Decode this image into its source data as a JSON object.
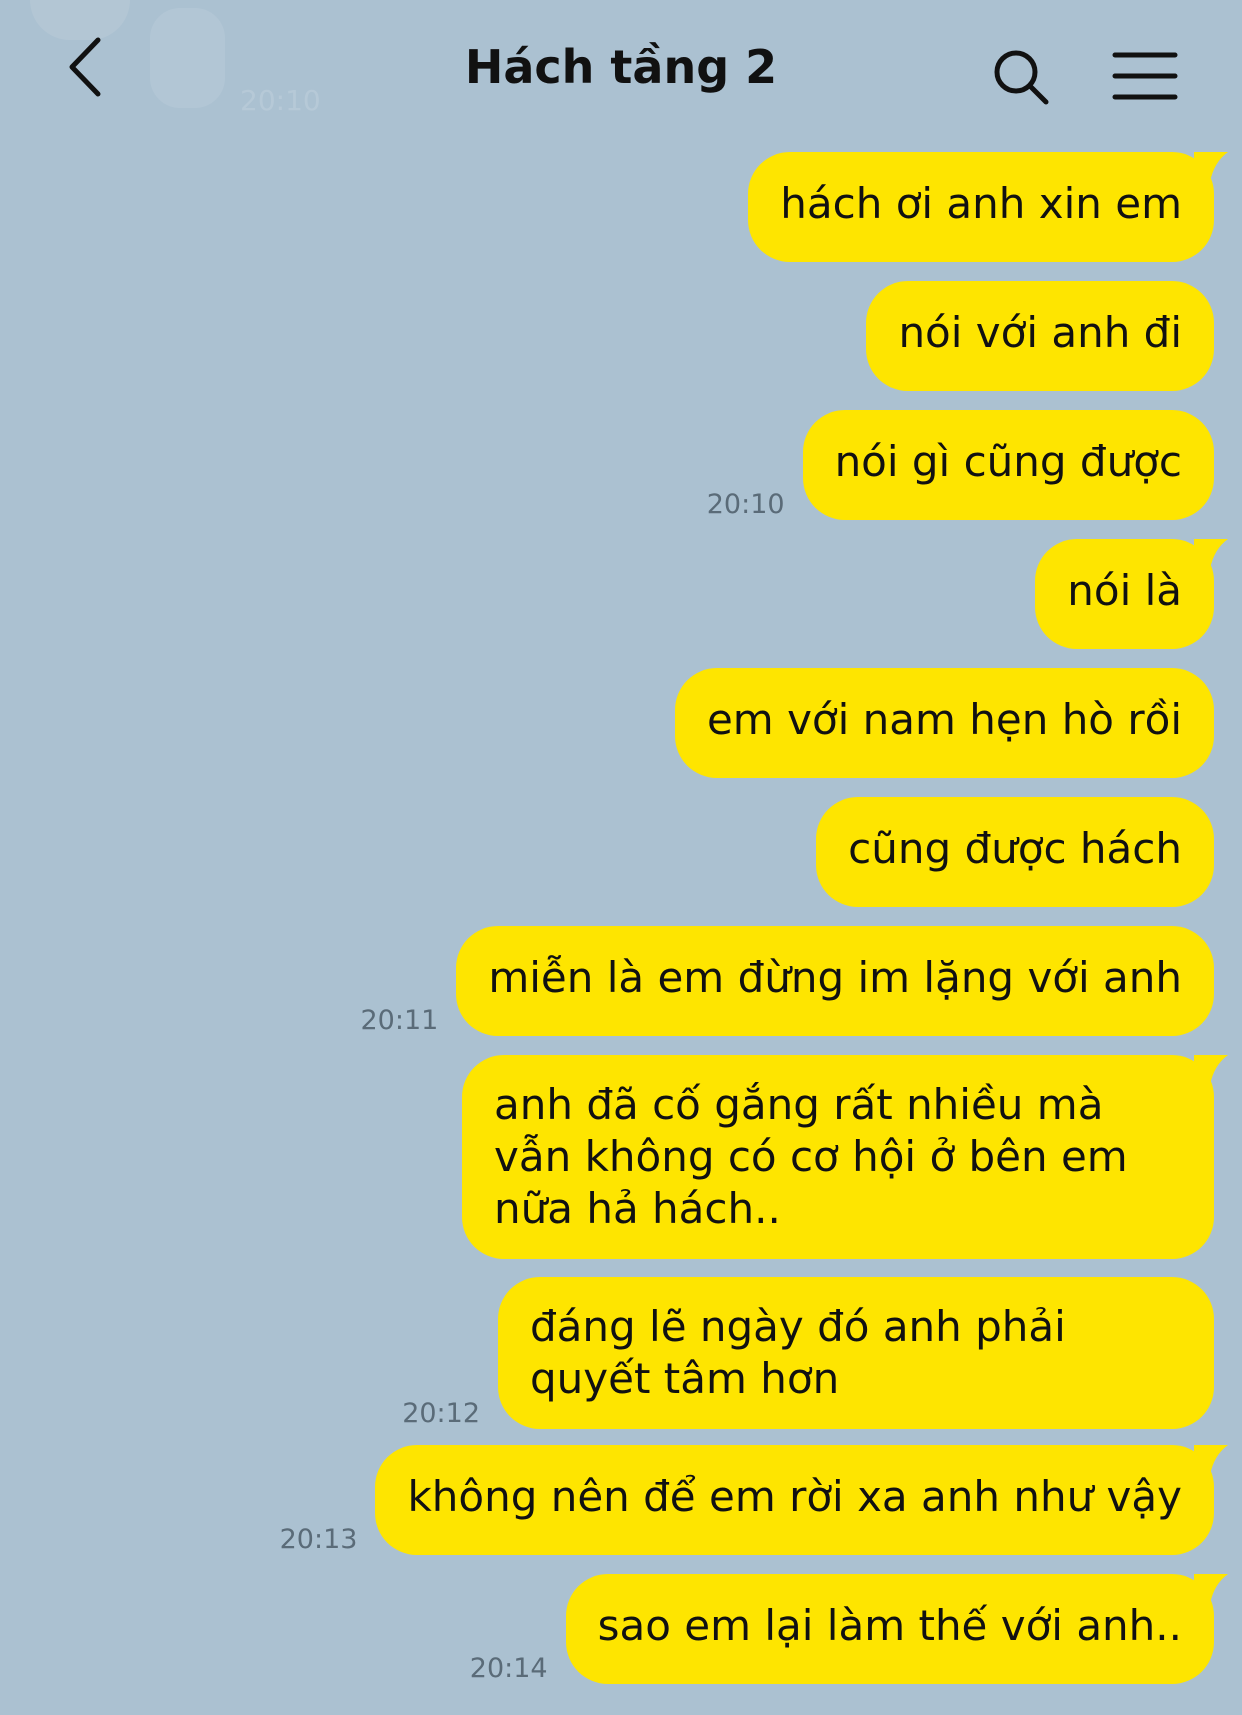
{
  "header": {
    "title": "Hách tầng 2",
    "ghost_time": "20:10",
    "back_icon": "chevron-left-icon",
    "search_icon": "search-icon",
    "menu_icon": "hamburger-menu-icon"
  },
  "colors": {
    "background": "#abc1d1",
    "bubble": "#fee500",
    "text": "#111111",
    "timestamp": "#5a6b78"
  },
  "messages": [
    {
      "text": "hách ơi anh xin em",
      "time": "",
      "tail": true
    },
    {
      "text": "nói với anh đi",
      "time": "",
      "tail": false
    },
    {
      "text": "nói gì cũng được",
      "time": "20:10",
      "tail": false
    },
    {
      "text": "nói là",
      "time": "",
      "tail": true
    },
    {
      "text": "em với nam hẹn hò rồi",
      "time": "",
      "tail": false
    },
    {
      "text": "cũng được hách",
      "time": "",
      "tail": false
    },
    {
      "text": "miễn là em đừng im lặng với anh",
      "time": "20:11",
      "tail": false
    },
    {
      "text": "anh đã cố gắng rất nhiều mà vẫn không có cơ hội ở bên em nữa hả hách..",
      "time": "",
      "tail": true
    },
    {
      "text": "đáng lẽ ngày đó anh phải quyết tâm hơn",
      "time": "20:12",
      "tail": false
    },
    {
      "text": "không nên để em rời xa anh như vậy",
      "time": "20:13",
      "tail": true
    },
    {
      "text": "sao em lại làm thế với anh..",
      "time": "20:14",
      "tail": true
    }
  ]
}
